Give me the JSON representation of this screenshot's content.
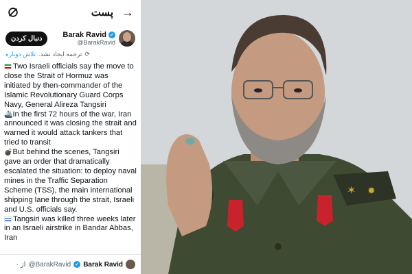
{
  "header": {
    "title": "پست",
    "back_icon": "arrow-right-icon",
    "logo_icon": "grok-logo-icon"
  },
  "author": {
    "name": "Barak Ravid",
    "handle": "@BarakRavid",
    "follow_label": "دنبال کردن",
    "verified": true
  },
  "translate": {
    "text": "ترجمه ایجاد نشد.",
    "retry": "تلاش دوباره"
  },
  "post": {
    "p1": "Two Israeli officials say the move to close the Strait of Hormuz was initiated by then-commander of the Islamic Revolutionary Guard Corps Navy, General Alireza Tangsiri",
    "p2": "In the first 72 hours of the war, Iran announced it was closing the strait and warned it would attack tankers that tried to transit",
    "p3": "But behind the scenes, Tangsiri gave an order that dramatically escalated the situation: to deploy naval mines in the Traffic Separation Scheme (TSS), the main international shipping lane through the strait, Israeli and U.S. officials say.",
    "p4": "Tangsiri was killed three weeks later in an Israeli airstrike in Bandar Abbas, Iran"
  },
  "quote_footer": {
    "name": "Barak Ravid",
    "handle": "@BarakRavid",
    "extra": "· از"
  },
  "colors": {
    "accent": "#1d9bf0",
    "uniform": "#3f4a33",
    "beret_red": "#c8232c",
    "text": "#0f1419"
  }
}
